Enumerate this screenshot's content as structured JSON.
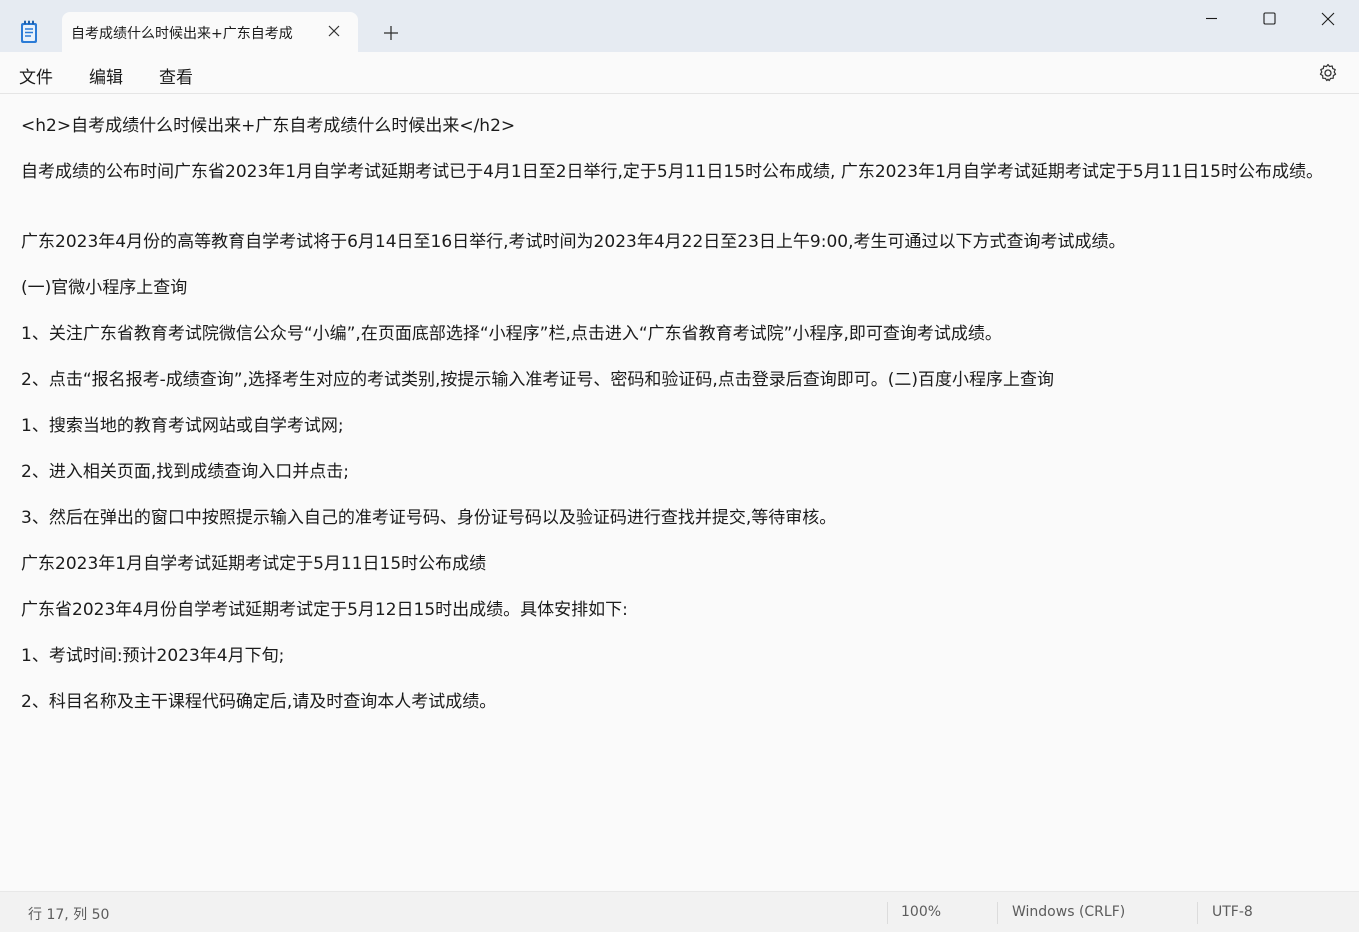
{
  "window": {
    "tab_title": "自考成绩什么时候出来+广东自考成",
    "controls": [
      "minimize-icon",
      "maximize-icon",
      "close-icon"
    ]
  },
  "menu": {
    "file": "文件",
    "edit": "编辑",
    "view": "查看"
  },
  "editor": {
    "lines": [
      "<h2>自考成绩什么时候出来+广东自考成绩什么时候出来</h2>",
      "自考成绩的公布时间广东省2023年1月自学考试延期考试已于4月1日至2日举行,定于5月11日15时公布成绩, 广东2023年1月自学考试延期考试定于5月11日15时公布成绩。",
      "广东2023年4月份的高等教育自学考试将于6月14日至16日举行,考试时间为2023年4月22日至23日上午9:00,考生可通过以下方式查询考试成绩。",
      "(一)官微小程序上查询",
      "1、关注广东省教育考试院微信公众号“小编”,在页面底部选择“小程序”栏,点击进入“广东省教育考试院”小程序,即可查询考试成绩。",
      "2、点击“报名报考-成绩查询”,选择考生对应的考试类别,按提示输入准考证号、密码和验证码,点击登录后查询即可。(二)百度小程序上查询",
      "1、搜索当地的教育考试网站或自学考试网;",
      "2、进入相关页面,找到成绩查询入口并点击;",
      "3、然后在弹出的窗口中按照提示输入自己的准考证号码、身份证号码以及验证码进行查找并提交,等待审核。",
      "广东2023年1月自学考试延期考试定于5月11日15时公布成绩",
      "广东省2023年4月份自学考试延期考试定于5月12日15时出成绩。具体安排如下:",
      "1、考试时间:预计2023年4月下旬;",
      "2、科目名称及主干课程代码确定后,请及时查询本人考试成绩。"
    ]
  },
  "status": {
    "position": "行 17, 列 50",
    "zoom": "100%",
    "line_ending": "Windows (CRLF)",
    "encoding": "UTF-8"
  }
}
